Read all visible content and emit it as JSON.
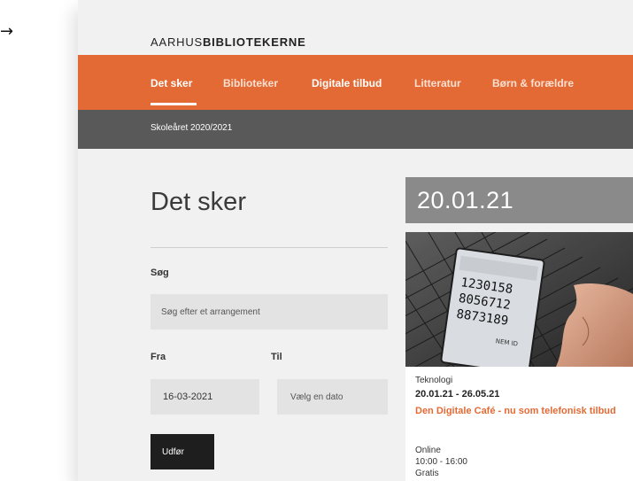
{
  "annotation": {
    "arrow": "→"
  },
  "brand": {
    "part1": "AARHUS",
    "part2": "BIBLIOTEKERNE"
  },
  "main_nav": {
    "items": [
      {
        "label": "Det sker"
      },
      {
        "label": "Biblioteker"
      },
      {
        "label": "Digitale tilbud"
      },
      {
        "label": "Litteratur"
      },
      {
        "label": "Børn & forældre"
      }
    ]
  },
  "sub_nav": {
    "items": [
      {
        "label": "Skoleåret 2020/2021"
      }
    ]
  },
  "filter": {
    "page_title": "Det sker",
    "search_label": "Søg",
    "search_placeholder": "Søg efter et arrangement",
    "from_label": "Fra",
    "from_value": "16-03-2021",
    "to_label": "Til",
    "to_placeholder": "Vælg en dato",
    "submit_label": "Udfør"
  },
  "events": {
    "date_header": "20.01.21",
    "card": {
      "category": "Teknologi",
      "date_range": "20.01.21 - 26.05.21",
      "title": "Den Digitale Café - nu som telefonisk tilbud",
      "location": "Online",
      "time": "10:00 - 16:00",
      "price": "Gratis"
    },
    "photo": {
      "icon": "smartphone-on-laptop-photo",
      "screen_text": [
        "1230158",
        "8056712",
        "8873189",
        "NEM ID"
      ]
    }
  },
  "colors": {
    "accent": "#e46a35",
    "subnav": "#595959",
    "date_header": "#8a8a8a",
    "button": "#1e1e1e",
    "input_bg": "#e3e3e3"
  }
}
